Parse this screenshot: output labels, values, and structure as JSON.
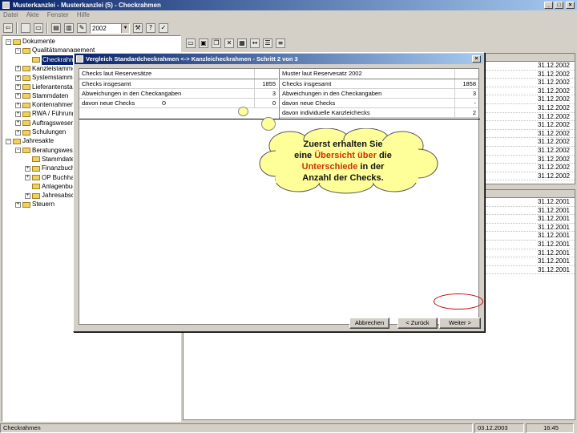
{
  "window": {
    "title": "Musterkanzlei - Musterkanzlei (5) - Checkrahmen"
  },
  "menu": [
    "Datei",
    "Akte",
    "Fenster",
    "Hilfe"
  ],
  "toolbar": {
    "year": "2002"
  },
  "tree": [
    {
      "label": "Dokumente",
      "level": 0,
      "expander": "−"
    },
    {
      "label": "Qualitätsmanagement",
      "level": 1,
      "expander": "−"
    },
    {
      "label": "Checkrahmen",
      "level": 2,
      "expander": "",
      "selected": true
    },
    {
      "label": "Kanzleistammdaten",
      "level": 1,
      "expander": "+"
    },
    {
      "label": "Systemstammdaten",
      "level": 1,
      "expander": "+"
    },
    {
      "label": "Lieferantenstammdaten",
      "level": 1,
      "expander": "+"
    },
    {
      "label": "Stammdaten",
      "level": 1,
      "expander": "+"
    },
    {
      "label": "Kontenrahmen",
      "level": 1,
      "expander": "+"
    },
    {
      "label": "RWA / Führung",
      "level": 1,
      "expander": "+"
    },
    {
      "label": "Auftragswesen",
      "level": 1,
      "expander": "+"
    },
    {
      "label": "Schulungen",
      "level": 1,
      "expander": "+"
    },
    {
      "label": "Jahresakte",
      "level": 0,
      "expander": "−"
    },
    {
      "label": "Beratungswesen",
      "level": 1,
      "expander": "−"
    },
    {
      "label": "Stammdaten",
      "level": 2,
      "expander": ""
    },
    {
      "label": "Finanzbuchhaltung",
      "level": 2,
      "expander": "+"
    },
    {
      "label": "OP Buchhaltung",
      "level": 2,
      "expander": "+"
    },
    {
      "label": "Anlagenbuchhaltung",
      "level": 2,
      "expander": ""
    },
    {
      "label": "Jahresabschluss",
      "level": 2,
      "expander": "+"
    },
    {
      "label": "Steuern",
      "level": 1,
      "expander": "+"
    }
  ],
  "right_panel": {
    "upper_dates": [
      "31.12.2002",
      "31.12.2002",
      "31.12.2002",
      "31.12.2002",
      "31.12.2002",
      "31.12.2002",
      "31.12.2002",
      "31.12.2002",
      "31.12.2002",
      "31.12.2002",
      "31.12.2002",
      "31.12.2002",
      "31.12.2002",
      "31.12.2002"
    ],
    "lower_dates": [
      "31.12.2001",
      "31.12.2001",
      "31.12.2001",
      "31.12.2001",
      "31.12.2001",
      "31.12.2001",
      "31.12.2001",
      "31.12.2001",
      "31.12.2001"
    ]
  },
  "dialog": {
    "title": "Vergleich Standardcheckrahmen <-> Kanzleicheckrahmen - Schritt 2 von 3",
    "left": {
      "header": "Checks laut Reservesätze",
      "rows": [
        {
          "label": "Checks insgesamt",
          "value": "1855"
        },
        {
          "label": "Abweichungen in den Checkangaben",
          "value": "3"
        },
        {
          "label": "davon neue Checks",
          "value": "0"
        }
      ]
    },
    "right": {
      "header": "Muster laut Reservesatz 2002",
      "rows": [
        {
          "label": "Checks insgesamt",
          "value": "1858"
        },
        {
          "label": "Abweichungen in den Checkangaben",
          "value": "3"
        },
        {
          "label": "davon neue Checks",
          "value": "-"
        },
        {
          "label": "davon individuelle Kanzleichecks",
          "value": "2"
        }
      ]
    },
    "buttons": {
      "cancel": "Abbrechen",
      "back": "< Zurück",
      "next": "Weiter >"
    }
  },
  "callout": {
    "line1": "Zuerst erhalten Sie",
    "line2_a": "eine",
    "line2_hl": "Übersicht über",
    "line2_b": "die",
    "line3_hl": "Unterschiede",
    "line3_b": "in der",
    "line4": "Anzahl der Checks.",
    "colors": {
      "fill": "#ffff99",
      "highlight": "#cc3300"
    }
  },
  "statusbar": {
    "left": "Checkrahmen",
    "date": "03.12.2003",
    "time": "16:45"
  }
}
